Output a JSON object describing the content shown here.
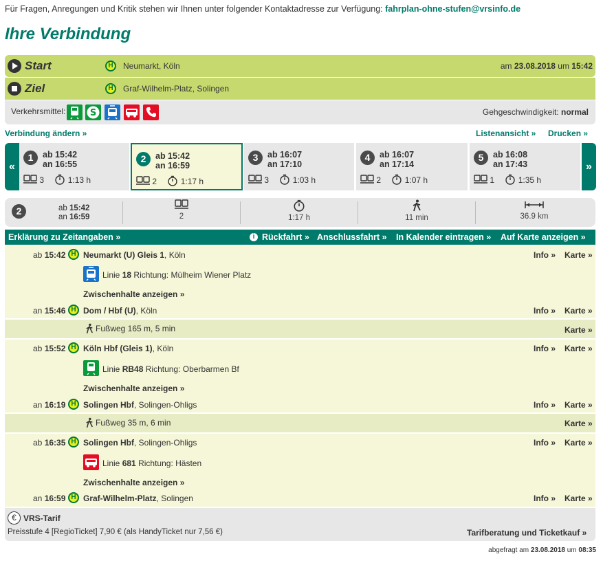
{
  "contact": {
    "text": "Für Fragen, Anregungen und Kritik stehen wir Ihnen unter folgender Kontaktadresse zur Verfügung:",
    "email": "fahrplan-ohne-stufen@vrsinfo.de"
  },
  "page_title": "Ihre Verbindung",
  "start": {
    "label": "Start",
    "stop": "Neumarkt, Köln",
    "date_prefix": "am",
    "date": "23.08.2018",
    "time_prefix": "um",
    "time": "15:42"
  },
  "ziel": {
    "label": "Ziel",
    "stop": "Graf-Wilhelm-Platz, Solingen"
  },
  "transport": {
    "label": "Verkehrsmittel:",
    "walk_speed_label": "Gehgeschwindigkeit:",
    "walk_speed": "normal",
    "modes": [
      {
        "icon": "train-icon",
        "color": "#0a9a3a"
      },
      {
        "icon": "sbahn-icon",
        "color": "#0a9a3a"
      },
      {
        "icon": "tram-icon",
        "color": "#1a73c8"
      },
      {
        "icon": "bus-icon",
        "color": "#e30e24"
      },
      {
        "icon": "phone-icon",
        "color": "#e30e24"
      }
    ]
  },
  "actions": {
    "change": "Verbindung ändern »",
    "list_view": "Listenansicht »",
    "print": "Drucken »"
  },
  "nav": {
    "prev": "«",
    "next": "»"
  },
  "connections": [
    {
      "num": "1",
      "dep": "ab 15:42",
      "arr": "an 16:55",
      "changes": "3",
      "duration": "1:13 h"
    },
    {
      "num": "2",
      "dep": "ab 15:42",
      "arr": "an 16:59",
      "changes": "2",
      "duration": "1:17 h"
    },
    {
      "num": "3",
      "dep": "ab 16:07",
      "arr": "an 17:10",
      "changes": "3",
      "duration": "1:03 h"
    },
    {
      "num": "4",
      "dep": "ab 16:07",
      "arr": "an 17:14",
      "changes": "2",
      "duration": "1:07 h"
    },
    {
      "num": "5",
      "dep": "ab 16:08",
      "arr": "an 17:43",
      "changes": "1",
      "duration": "1:35 h"
    }
  ],
  "summary": {
    "num": "2",
    "dep_prefix": "ab",
    "dep": "15:42",
    "arr_prefix": "an",
    "arr": "16:59",
    "changes": "2",
    "duration": "1:17 h",
    "walk": "11 min",
    "distance": "36.9 km"
  },
  "toolbar": {
    "explain": "Erklärung zu Zeitangaben »",
    "return": "Rückfahrt »",
    "connection": "Anschlussfahrt »",
    "calendar": "In Kalender eintragen »",
    "map": "Auf Karte anzeigen »"
  },
  "links": {
    "info": "Info »",
    "karte": "Karte »",
    "stops": "Zwischenhalte anzeigen »"
  },
  "legs": {
    "l1_dep": {
      "kind": "ab",
      "time": "15:42",
      "stop": "Neumarkt (U) Gleis 1",
      "city": ", Köln"
    },
    "l1_line": {
      "prefix": "Linie",
      "line": "18",
      "dir_label": "Richtung:",
      "direction": "Mülheim Wiener Platz"
    },
    "l1_arr": {
      "kind": "an",
      "time": "15:46",
      "stop": "Dom / Hbf (U)",
      "city": ", Köln"
    },
    "walk1": "Fußweg 165 m, 5 min",
    "l2_dep": {
      "kind": "ab",
      "time": "15:52",
      "stop": "Köln Hbf (Gleis 1)",
      "city": ", Köln"
    },
    "l2_line": {
      "prefix": "Linie",
      "line": "RB48",
      "dir_label": "Richtung:",
      "direction": "Oberbarmen Bf"
    },
    "l2_arr": {
      "kind": "an",
      "time": "16:19",
      "stop": "Solingen Hbf",
      "city": ", Solingen-Ohligs"
    },
    "walk2": "Fußweg 35 m, 6 min",
    "l3_dep": {
      "kind": "ab",
      "time": "16:35",
      "stop": "Solingen Hbf",
      "city": ", Solingen-Ohligs"
    },
    "l3_line": {
      "prefix": "Linie",
      "line": "681",
      "dir_label": "Richtung:",
      "direction": "Hästen"
    },
    "l3_arr": {
      "kind": "an",
      "time": "16:59",
      "stop": "Graf-Wilhelm-Platz",
      "city": ", Solingen"
    }
  },
  "tariff": {
    "title": "VRS-Tarif",
    "text": "Preisstufe 4 [RegioTicket] 7,90 € (als HandyTicket nur 7,56 €)",
    "link": "Tarifberatung und Ticketkauf »"
  },
  "footer": {
    "prefix": "abgefragt am",
    "date": "23.08.2018",
    "time_prefix": "um",
    "time": "08:35"
  }
}
